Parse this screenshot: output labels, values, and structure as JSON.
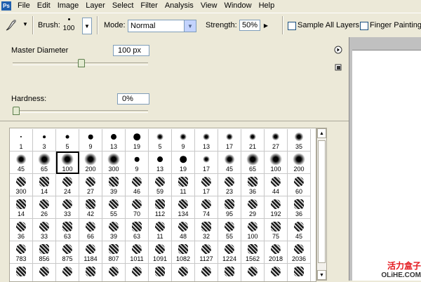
{
  "menu": [
    "File",
    "Edit",
    "Image",
    "Layer",
    "Select",
    "Filter",
    "Analysis",
    "View",
    "Window",
    "Help"
  ],
  "app_logo": "Ps",
  "options": {
    "brush_label": "Brush:",
    "brush_size": "100",
    "mode_label": "Mode:",
    "mode_value": "Normal",
    "strength_label": "Strength:",
    "strength_value": "50%",
    "sample_all_layers": "Sample All Layers",
    "finger_painting": "Finger Painting"
  },
  "panel": {
    "master_diameter_label": "Master Diameter",
    "master_diameter_value": "100 px",
    "master_diameter_level": 0.5,
    "hardness_label": "Hardness:",
    "hardness_value": "0%",
    "hardness_level": 0.0
  },
  "brushes": [
    [
      "1",
      "3",
      "5",
      "9",
      "13",
      "19",
      "5",
      "9",
      "13",
      "17",
      "21",
      "27",
      "35"
    ],
    [
      "45",
      "65",
      "100",
      "200",
      "300",
      "9",
      "13",
      "19",
      "17",
      "45",
      "65",
      "100",
      "200"
    ],
    [
      "300",
      "14",
      "24",
      "27",
      "39",
      "46",
      "59",
      "11",
      "17",
      "23",
      "36",
      "44",
      "60"
    ],
    [
      "14",
      "26",
      "33",
      "42",
      "55",
      "70",
      "112",
      "134",
      "74",
      "95",
      "29",
      "192",
      "36"
    ],
    [
      "36",
      "33",
      "63",
      "66",
      "39",
      "63",
      "11",
      "48",
      "32",
      "55",
      "100",
      "75",
      "45"
    ],
    [
      "783",
      "856",
      "875",
      "1184",
      "807",
      "1011",
      "1091",
      "1082",
      "1127",
      "1224",
      "1562",
      "2018",
      "2036"
    ],
    [
      "",
      "",
      "",
      "",
      "",
      "",
      "",
      "",
      "",
      "",
      "",
      "",
      ""
    ]
  ],
  "selected_brush": "100",
  "watermark": {
    "cn": "活力盒子",
    "en": "OLiHE.COM"
  },
  "colors": {
    "ui_bg": "#ece9d8",
    "input_border": "#7f9db9",
    "watermark": "#e4151b"
  }
}
